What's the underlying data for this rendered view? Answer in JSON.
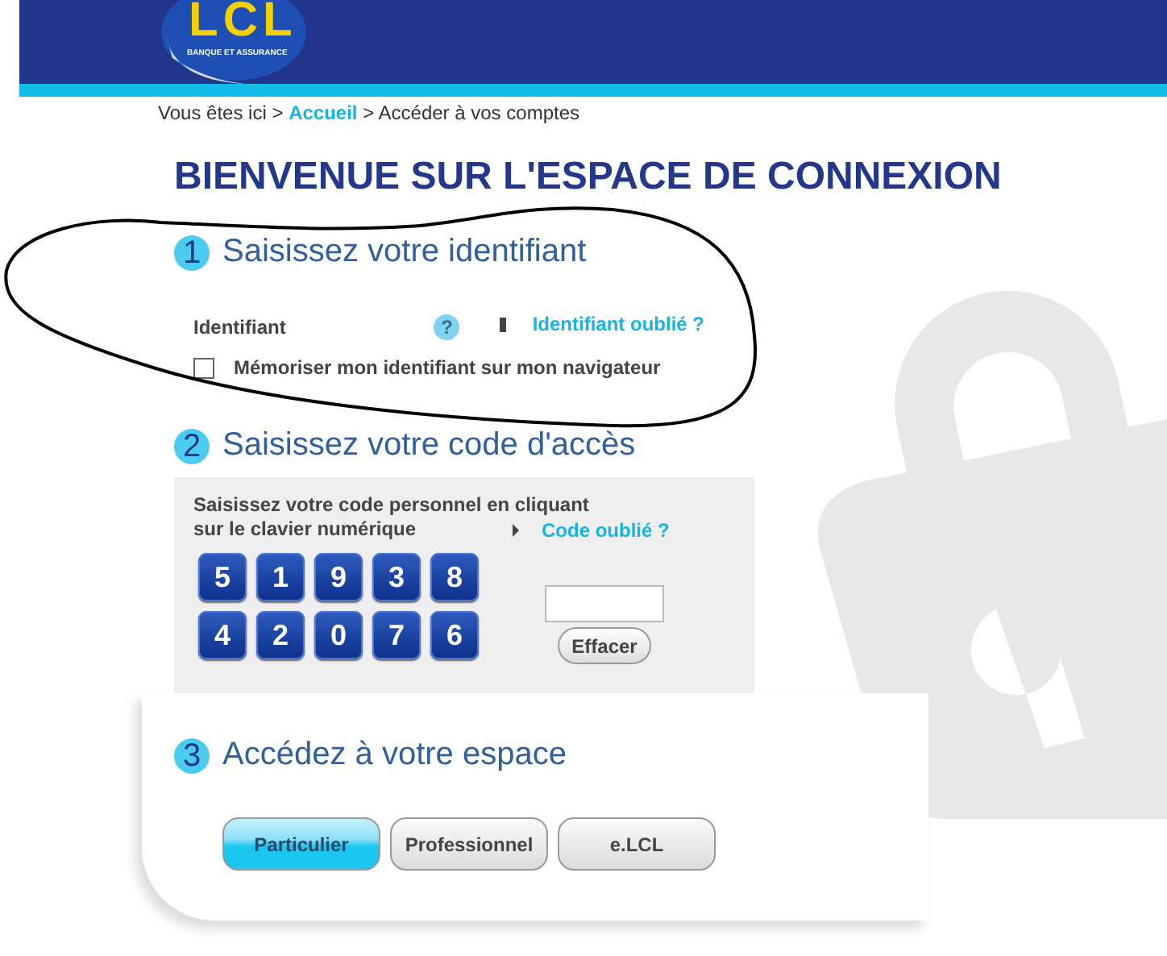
{
  "header": {
    "logo": "LCL",
    "tagline": "BANQUE ET ASSURANCE"
  },
  "breadcrumb": {
    "prefix": "Vous êtes ici >",
    "link": "Accueil",
    "current": "> Accéder à vos comptes"
  },
  "title": "BIENVENUE SUR L'ESPACE DE CONNEXION",
  "steps": [
    {
      "number": "1",
      "title": "Saisissez votre identifiant"
    },
    {
      "number": "2",
      "title": "Saisissez votre code d'accès"
    },
    {
      "number": "3",
      "title": "Accédez à votre espace"
    }
  ],
  "identifier": {
    "label": "Identifiant",
    "help": "?",
    "forgot": "Identifiant oublié ?",
    "remember": {
      "label": "Mémoriser mon identifiant sur mon navigateur",
      "checked": false
    }
  },
  "code": {
    "instructions": [
      "Saisissez votre code personnel en cliquant",
      "sur le clavier numérique"
    ],
    "forgot": "Code oublié ?",
    "keys": [
      "5",
      "1",
      "9",
      "3",
      "8",
      "4",
      "2",
      "0",
      "7",
      "6"
    ],
    "clear": "Effacer"
  },
  "spaces": [
    {
      "label": "Particulier",
      "selected": true
    },
    {
      "label": "Professionnel",
      "selected": false
    },
    {
      "label": "e.LCL",
      "selected": false
    }
  ]
}
